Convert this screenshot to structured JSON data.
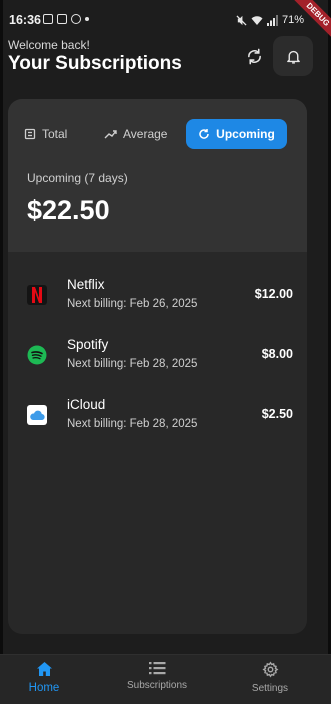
{
  "status_bar": {
    "time": "16:36",
    "battery": "71%",
    "debug_label": "DEBUG"
  },
  "header": {
    "welcome": "Welcome back!",
    "title": "Your Subscriptions",
    "refresh_icon": "refresh-icon",
    "bell_icon": "bell-icon"
  },
  "summary": {
    "tabs": [
      {
        "label": "Total",
        "icon": "receipt-icon",
        "active": false
      },
      {
        "label": "Average",
        "icon": "trend-icon",
        "active": false
      },
      {
        "label": "Upcoming",
        "icon": "refresh-circle-icon",
        "active": true
      }
    ],
    "period_label": "Upcoming (7 days)",
    "amount": "$22.50"
  },
  "subscriptions": [
    {
      "name": "Netflix",
      "next_billing": "Next billing: Feb 26, 2025",
      "price": "$12.00",
      "icon": "netflix-logo"
    },
    {
      "name": "Spotify",
      "next_billing": "Next billing: Feb 28, 2025",
      "price": "$8.00",
      "icon": "spotify-logo"
    },
    {
      "name": "iCloud",
      "next_billing": "Next billing: Feb 28, 2025",
      "price": "$2.50",
      "icon": "icloud-logo"
    }
  ],
  "bottom_nav": [
    {
      "label": "Home",
      "icon": "home-icon",
      "active": true
    },
    {
      "label": "Subscriptions",
      "icon": "list-icon",
      "active": false
    },
    {
      "label": "Settings",
      "icon": "gear-icon",
      "active": false
    }
  ],
  "colors": {
    "background": "#1d1d1d",
    "card": "#282828",
    "summary_panel": "#333333",
    "accent": "#1e88e5",
    "nav_active": "#2196f3",
    "netflix": "#e50914",
    "spotify": "#1db954"
  }
}
